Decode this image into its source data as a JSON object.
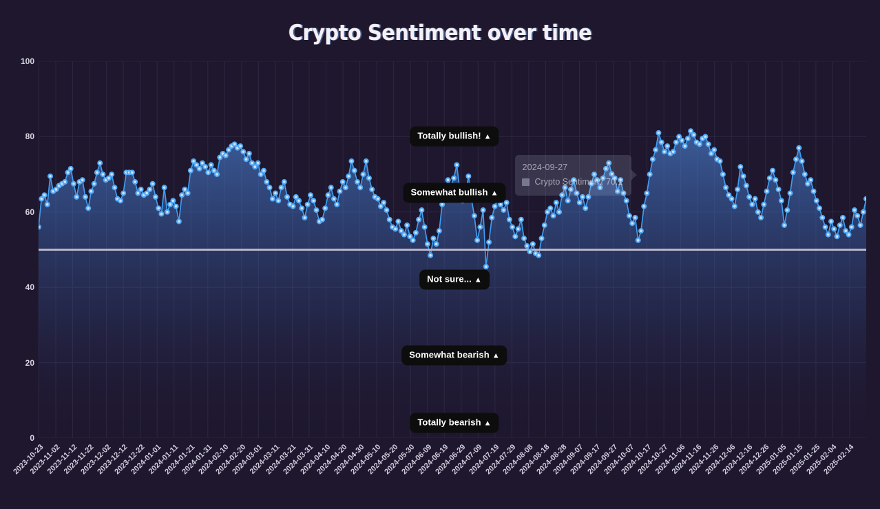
{
  "title": "Crypto Sentiment over time",
  "colors": {
    "background": "#1e172e",
    "line": "#3f9cf0",
    "marker_fill": "#cfe4fb",
    "marker_stroke": "#54aaf5",
    "grid": "#2e2742",
    "tick_text": "#cfcddb",
    "reference_line": "#b8b6c8",
    "pill_background": "#0d0d0d",
    "pill_text": "#ffffff"
  },
  "tooltip": {
    "date": "2024-09-27",
    "series_label": "Crypto Sentiment",
    "value": "70.1",
    "text": "Crypto Sentiment: 70.1"
  },
  "sentiment_labels": [
    {
      "text": "Totally bullish!",
      "caret": "▲",
      "y_value": 80
    },
    {
      "text": "Somewhat bullish",
      "caret": "▲",
      "y_value": 65
    },
    {
      "text": "Not sure...",
      "caret": "▲",
      "y_value": 42
    },
    {
      "text": "Somewhat bearish",
      "caret": "▲",
      "y_value": 22
    },
    {
      "text": "Totally bearish",
      "caret": "▲",
      "y_value": 4
    }
  ],
  "chart_data": {
    "type": "line",
    "title": "Crypto Sentiment over time",
    "xlabel": "",
    "ylabel": "",
    "ylim": [
      0,
      100
    ],
    "yticks": [
      0,
      20,
      40,
      60,
      80,
      100
    ],
    "grid": true,
    "legend": "none",
    "reference_line": {
      "y": 50,
      "color": "#b8b6c8"
    },
    "xtick_labels": [
      "2023-10-23",
      "2023-11-02",
      "2023-11-12",
      "2023-11-22",
      "2023-12-02",
      "2023-12-12",
      "2023-12-22",
      "2024-01-01",
      "2024-01-11",
      "2024-01-21",
      "2024-01-31",
      "2024-02-10",
      "2024-02-20",
      "2024-03-01",
      "2024-03-11",
      "2024-03-21",
      "2024-03-31",
      "2024-04-10",
      "2024-04-20",
      "2024-04-30",
      "2024-05-10",
      "2024-05-20",
      "2024-05-30",
      "2024-06-09",
      "2024-06-19",
      "2024-06-29",
      "2024-07-09",
      "2024-07-19",
      "2024-07-29",
      "2024-08-08",
      "2024-08-18",
      "2024-08-28",
      "2024-09-07",
      "2024-09-17",
      "2024-09-27",
      "2024-10-07",
      "2024-10-17",
      "2024-10-27",
      "2024-11-06",
      "2024-11-16",
      "2024-11-26",
      "2024-12-06",
      "2024-12-16",
      "2024-12-26",
      "2025-01-05",
      "2025-01-15",
      "2025-01-25",
      "2025-02-04",
      "2025-02-14"
    ],
    "start_date": "2023-10-23",
    "end_date": "2025-02-19",
    "series": [
      {
        "name": "Crypto Sentiment",
        "color": "#3f9cf0",
        "values": [
          56.0,
          63.5,
          64.5,
          62.0,
          69.5,
          65.5,
          66.0,
          67.0,
          67.5,
          68.0,
          70.5,
          71.5,
          67.5,
          64.0,
          68.0,
          68.5,
          64.0,
          61.0,
          65.5,
          67.5,
          70.5,
          73.0,
          70.0,
          68.5,
          69.0,
          70.0,
          66.5,
          63.5,
          63.0,
          65.0,
          70.5,
          70.5,
          70.5,
          68.0,
          65.0,
          66.0,
          64.5,
          65.0,
          66.0,
          67.5,
          64.0,
          61.0,
          59.5,
          66.5,
          60.0,
          62.0,
          63.0,
          61.5,
          57.5,
          64.5,
          66.0,
          65.0,
          71.0,
          73.5,
          72.5,
          71.5,
          73.0,
          72.0,
          70.5,
          72.5,
          71.0,
          70.0,
          74.5,
          75.5,
          75.0,
          76.5,
          77.5,
          78.0,
          77.0,
          77.5,
          76.0,
          74.0,
          75.5,
          73.0,
          72.0,
          73.0,
          70.0,
          71.0,
          68.0,
          66.5,
          63.5,
          65.0,
          63.0,
          66.5,
          68.0,
          64.0,
          62.0,
          61.5,
          64.0,
          63.0,
          61.0,
          58.5,
          62.0,
          64.5,
          63.0,
          60.5,
          57.5,
          58.0,
          61.0,
          64.5,
          66.5,
          63.5,
          62.0,
          65.5,
          68.0,
          66.5,
          69.5,
          73.5,
          71.0,
          68.0,
          66.5,
          70.0,
          73.5,
          69.0,
          66.0,
          64.0,
          63.5,
          61.5,
          62.5,
          60.5,
          58.0,
          56.0,
          55.5,
          57.5,
          55.0,
          54.0,
          56.5,
          53.5,
          52.5,
          54.5,
          58.0,
          60.5,
          56.0,
          51.5,
          48.5,
          53.0,
          51.5,
          55.0,
          62.0,
          66.0,
          68.5,
          67.0,
          69.0,
          72.5,
          66.0,
          63.0,
          65.0,
          69.5,
          63.5,
          59.0,
          52.5,
          56.0,
          60.5,
          45.5,
          52.0,
          58.5,
          61.5,
          63.5,
          62.0,
          60.5,
          62.5,
          58.0,
          56.0,
          53.5,
          55.5,
          58.0,
          53.0,
          51.0,
          49.5,
          51.5,
          49.0,
          48.5,
          53.0,
          56.5,
          60.0,
          61.0,
          59.0,
          62.5,
          60.0,
          64.5,
          66.5,
          63.0,
          66.0,
          68.5,
          65.0,
          62.5,
          64.0,
          61.0,
          64.0,
          67.5,
          70.0,
          68.5,
          66.5,
          69.0,
          71.5,
          73.0,
          70.1,
          69.0,
          65.5,
          68.5,
          65.0,
          63.0,
          59.0,
          57.0,
          58.5,
          52.5,
          55.0,
          61.5,
          65.0,
          70.0,
          74.0,
          76.5,
          81.0,
          78.5,
          76.0,
          77.5,
          75.5,
          76.0,
          78.5,
          80.0,
          79.0,
          77.5,
          79.5,
          81.5,
          80.5,
          78.5,
          78.0,
          79.5,
          80.0,
          78.0,
          75.5,
          76.5,
          74.0,
          73.5,
          70.0,
          66.5,
          64.5,
          63.5,
          61.5,
          66.0,
          72.0,
          69.5,
          67.0,
          64.0,
          62.0,
          63.5,
          60.0,
          58.5,
          62.0,
          65.5,
          69.0,
          71.0,
          68.5,
          66.0,
          63.0,
          56.5,
          60.5,
          65.0,
          70.5,
          74.0,
          77.0,
          73.5,
          70.0,
          67.5,
          68.5,
          65.5,
          63.0,
          61.0,
          58.5,
          56.0,
          54.0,
          57.5,
          55.5,
          53.5,
          56.5,
          58.5,
          55.0,
          54.0,
          56.0,
          60.5,
          59.0,
          56.5,
          60.0,
          63.5
        ]
      }
    ]
  }
}
